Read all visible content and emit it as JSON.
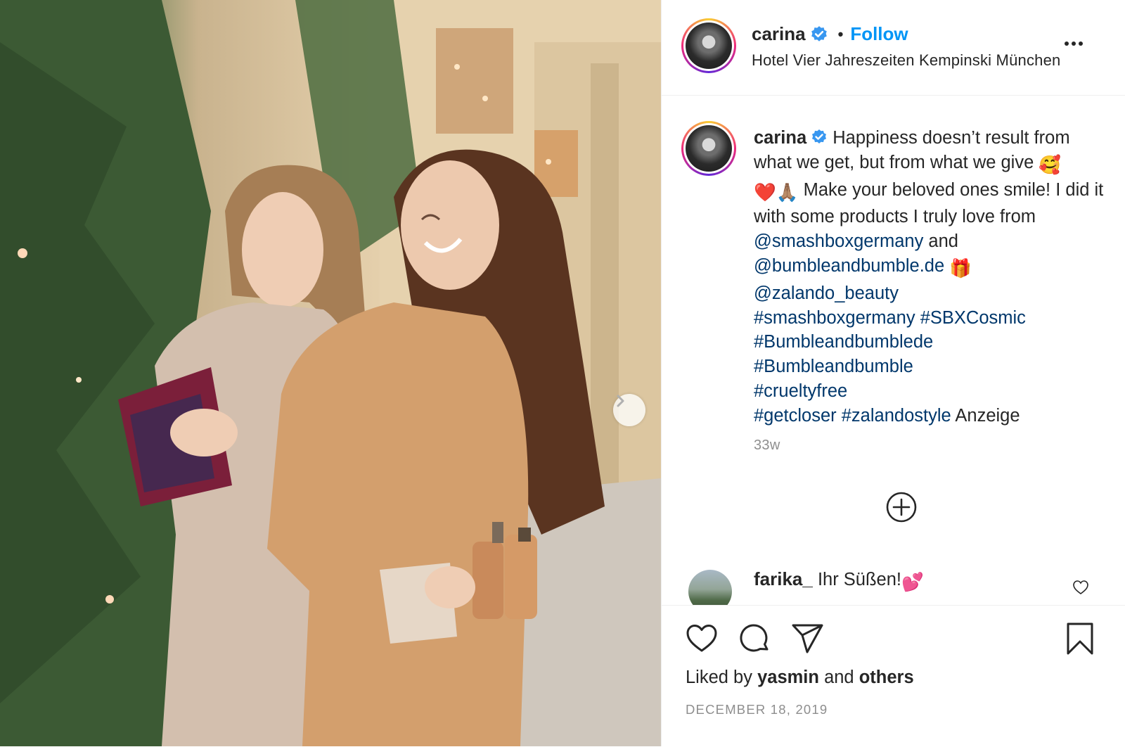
{
  "header": {
    "username": "carina",
    "separator": "•",
    "follow_label": "Follow",
    "location": "Hotel Vier Jahreszeiten Kempinski München"
  },
  "caption": {
    "username": "carina",
    "text_1": "Happiness doesn’t result from what we get, but from what we give",
    "emoji_1": "🥰",
    "emoji_2": "❤️",
    "emoji_3": "🙏🏽",
    "text_2": "Make your beloved ones smile! I did it with some products I truly love from",
    "mention_1": "@smashboxgermany",
    "text_3": "and",
    "mention_2": "@bumbleandbumble.de",
    "emoji_4": "🎁",
    "mention_3": "@zalando_beauty",
    "hashtag_1": "#smashboxgermany",
    "hashtag_2": "#SBXCosmic",
    "hashtag_3": "#Bumbleandbumblede",
    "hashtag_4": "#Bumbleandbumble",
    "hashtag_5": "#crueltyfree",
    "hashtag_6": "#getcloser",
    "hashtag_7": "#zalandostyle",
    "text_4": "Anzeige",
    "time_ago": "33w"
  },
  "comment": {
    "username": "farika_",
    "text": "Ihr Süßen!",
    "emoji": "💕"
  },
  "likes": {
    "prefix": "Liked by",
    "user": "yasmin",
    "conj": "and",
    "others": "others"
  },
  "post_date": "DECEMBER 18, 2019",
  "colors": {
    "link_blue": "#00376b",
    "follow_blue": "#0095f6",
    "verified_blue": "#3897f0",
    "muted": "#8e8e8e"
  },
  "icons": [
    "verified-badge-icon",
    "more-options-icon",
    "next-arrow-icon",
    "load-more-comments-icon",
    "like-icon",
    "comment-icon",
    "share-icon",
    "save-icon",
    "comment-like-icon"
  ]
}
